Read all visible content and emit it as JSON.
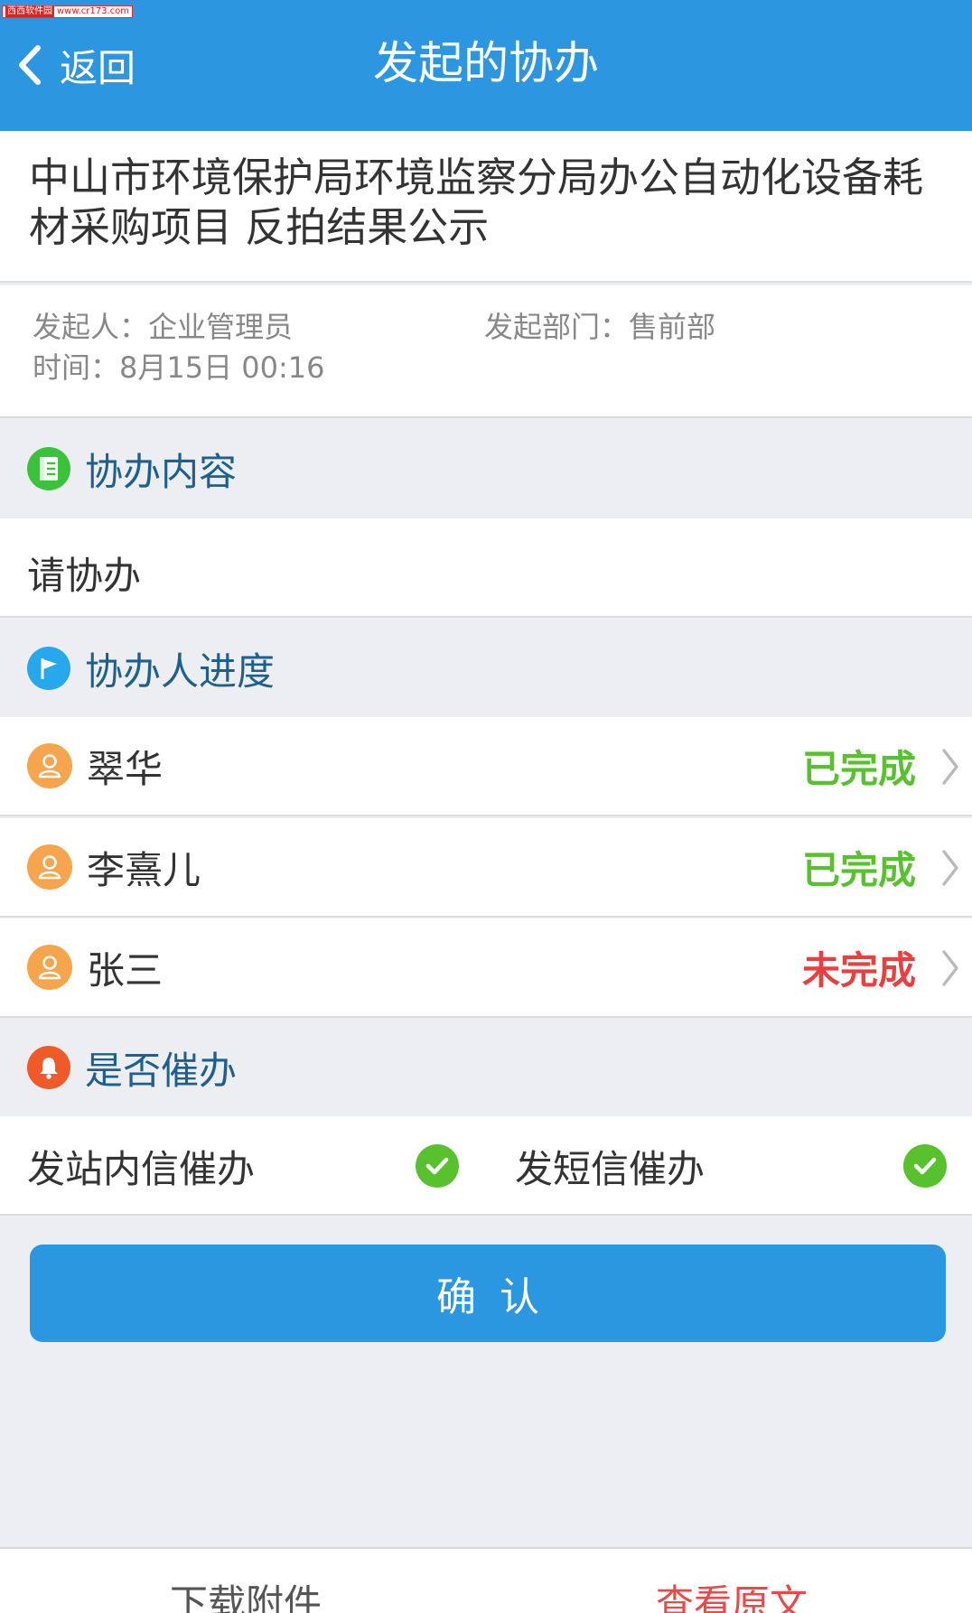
{
  "watermark": {
    "brand": "西西软件园",
    "url": "www.cr173.com"
  },
  "nav": {
    "back_label": "返回",
    "title": "发起的协办"
  },
  "subject": "中山市环境保护局环境监察分局办公自动化设备耗材采购项目 反拍结果公示",
  "meta": {
    "initiator": "发起人：企业管理员",
    "department": "发起部门：售前部",
    "time": "时间：8月15日 00:16"
  },
  "sections": {
    "content": {
      "title": "协办内容",
      "icon": "note-icon",
      "color": "#3ac33a"
    },
    "progress": {
      "title": "协办人进度",
      "icon": "flag-icon",
      "color": "#27a7ec"
    },
    "remind": {
      "title": "是否催办",
      "icon": "bell-icon",
      "color": "#f05a28"
    }
  },
  "content_text": "请协办",
  "assignees": [
    {
      "name": "翠华",
      "status": "已完成",
      "done": true
    },
    {
      "name": "李熹儿",
      "status": "已完成",
      "done": true
    },
    {
      "name": "张三",
      "status": "未完成",
      "done": false
    }
  ],
  "remind": {
    "internal_label": "发站内信催办",
    "internal_checked": true,
    "sms_label": "发短信催办",
    "sms_checked": true
  },
  "confirm_label": "确认",
  "bottom": {
    "download_label": "下载附件",
    "view_label": "查看原文"
  },
  "colors": {
    "nav": "#2c97e0",
    "done": "#57c22e",
    "todo": "#ea3f3f",
    "avatar": "#f6a54c"
  }
}
